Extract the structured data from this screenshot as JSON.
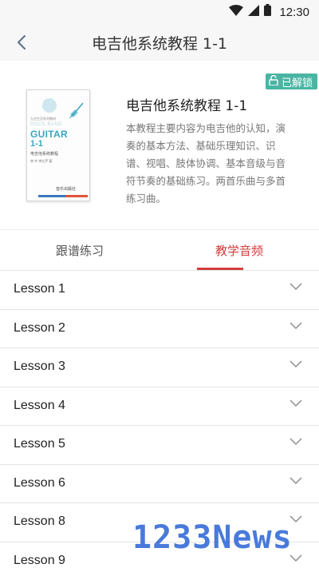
{
  "status_bar": {
    "time": "12:30",
    "icons": [
      "wifi-icon",
      "signal-icon",
      "battery-icon"
    ]
  },
  "nav": {
    "title": "电吉他系统教程 1-1",
    "back_icon": "chevron-left-icon"
  },
  "badge": {
    "label": "已解锁",
    "icon": "unlock-icon",
    "color": "#4bb5a4"
  },
  "course": {
    "title": "电吉他系统教程 1-1",
    "description": "本教程主要内容为电吉他的认知，演奏的基本方法、基础乐理知识、识谱、视唱、肢体协调、基本音级与音符节奏的基础练习。两首乐曲与多首练习曲。",
    "cover": {
      "series": "九在生活系列教材",
      "pre_title": "ROCK BAND",
      "guitar": "GUITAR",
      "number": "1-1",
      "subtitle": "电吉他系统教程",
      "authors": "李 卉    李红芹   著",
      "publisher": "音乐出版社"
    }
  },
  "tabs": [
    {
      "label": "跟谱练习",
      "active": false
    },
    {
      "label": "教学音频",
      "active": true
    }
  ],
  "accent_color": "#d33d3d",
  "lessons": [
    {
      "label": "Lesson 1"
    },
    {
      "label": "Lesson 2"
    },
    {
      "label": "Lesson 3"
    },
    {
      "label": "Lesson 4"
    },
    {
      "label": "Lesson 5"
    },
    {
      "label": "Lesson 6"
    },
    {
      "label": "Lesson 8"
    },
    {
      "label": "Lesson 9"
    }
  ],
  "watermark": "1233News"
}
